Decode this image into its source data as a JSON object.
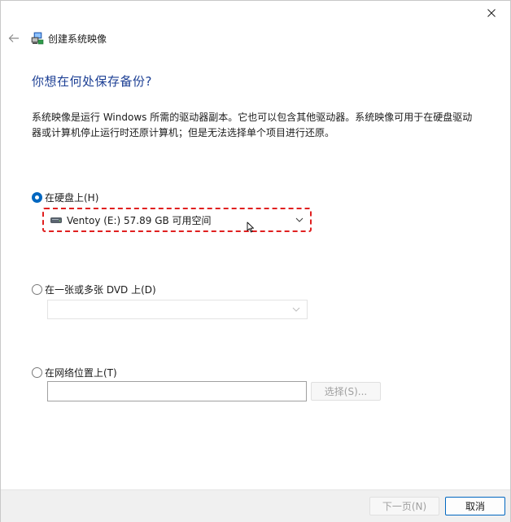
{
  "window": {
    "title": "创建系统映像"
  },
  "page": {
    "heading": "你想在何处保存备份?",
    "description": "系统映像是运行 Windows 所需的驱动器副本。它也可以包含其他驱动器。系统映像可用于在硬盘驱动器或计算机停止运行时还原计算机；但是无法选择单个项目进行还原。"
  },
  "options": {
    "hard_disk": {
      "label": "在硬盘上(H)",
      "selected": true,
      "dropdown_value": "Ventoy (E:)  57.89 GB 可用空间"
    },
    "dvd": {
      "label": "在一张或多张 DVD 上(D)",
      "selected": false,
      "dropdown_value": ""
    },
    "network": {
      "label": "在网络位置上(T)",
      "selected": false,
      "input_value": "",
      "select_label": "选择(S)..."
    }
  },
  "footer": {
    "next_label": "下一页(N)",
    "cancel_label": "取消"
  },
  "colors": {
    "heading": "#1c3f94",
    "accent": "#0067c0",
    "highlight_border": "#e02020"
  },
  "icons": {
    "close": "close-icon",
    "back": "back-arrow-icon",
    "app": "system-image-icon",
    "drive": "drive-icon",
    "chevron": "chevron-down-icon"
  }
}
